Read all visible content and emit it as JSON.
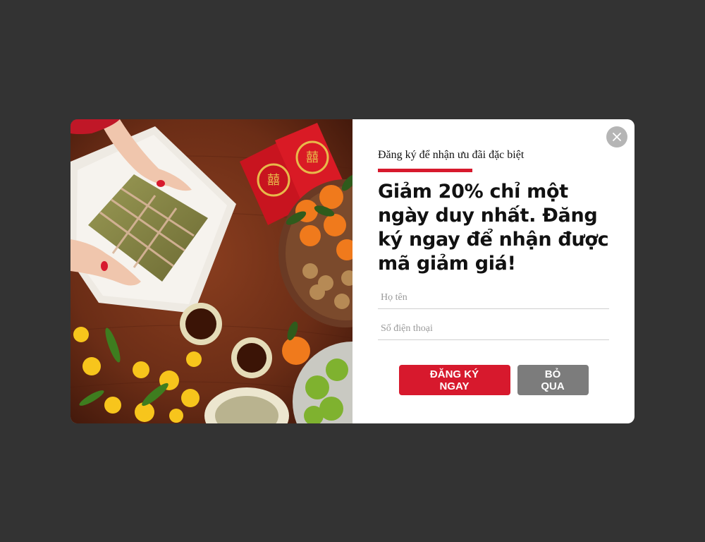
{
  "popup": {
    "subtitle": "Đăng ký để nhận ưu đãi đặc biệt",
    "headline": "Giảm 20% chỉ một ngày duy nhất. Đăng ký ngay để nhận được mã giảm giá!",
    "fields": {
      "name_placeholder": "Họ tên",
      "name_value": "",
      "phone_placeholder": "Số điện thoại",
      "phone_value": ""
    },
    "buttons": {
      "register_label": "ĐĂNG KÝ NGAY",
      "skip_label": "BỎ QUA"
    },
    "close_icon": "close-icon",
    "hero_image": "tet-banh-chung-table-photo"
  },
  "colors": {
    "overlay": "#333333",
    "accent": "#d7192d",
    "secondary_button": "#7c7c7c",
    "close_button": "#b5b5b5"
  }
}
